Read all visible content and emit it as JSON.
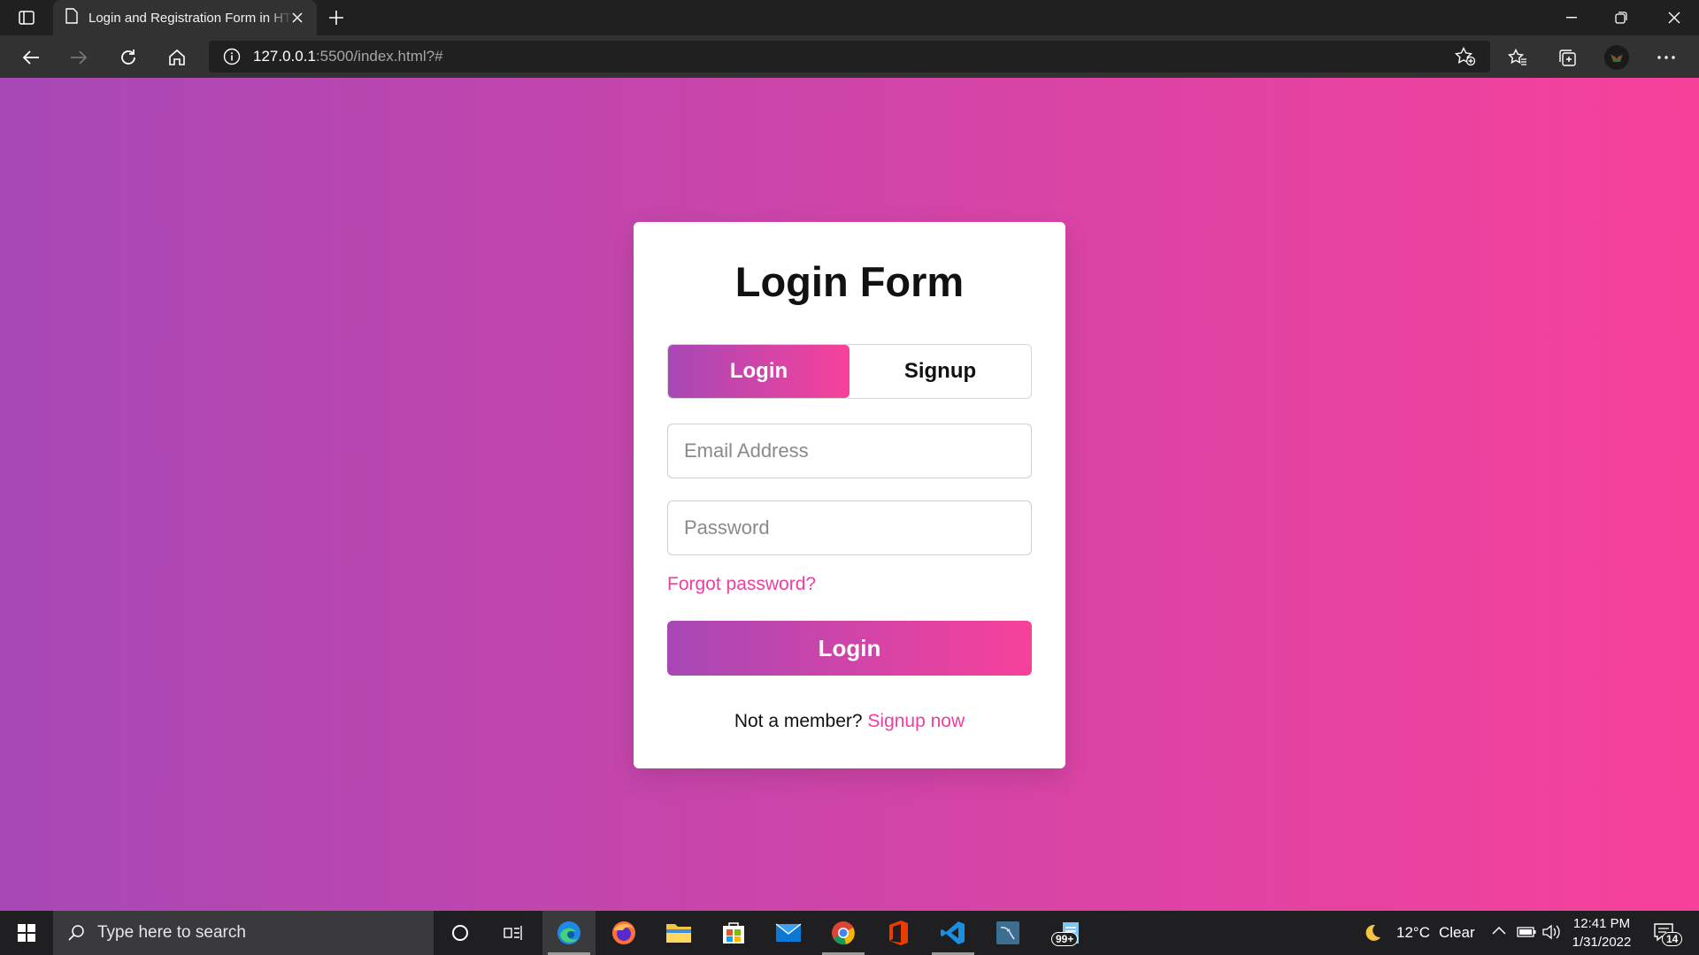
{
  "browser": {
    "tab_title": "Login and Registration Form in HTML",
    "url_host": "127.0.0.1",
    "url_rest": ":5500/index.html?#"
  },
  "form": {
    "title": "Login Form",
    "switch_login": "Login",
    "switch_signup": "Signup",
    "email_placeholder": "Email Address",
    "password_placeholder": "Password",
    "forgot_link": "Forgot password?",
    "submit_label": "Login",
    "member_text": "Not a member?",
    "signup_link": "Signup now"
  },
  "colors": {
    "gradient_start": "#a748b6",
    "gradient_end": "#f7419b",
    "link": "#ee3fa0"
  },
  "taskbar": {
    "search_placeholder": "Type here to search",
    "weather_temp": "12°C",
    "weather_cond": "Clear",
    "time": "12:41 PM",
    "date": "1/31/2022",
    "notification_count": "14",
    "app_badge": "99+"
  }
}
